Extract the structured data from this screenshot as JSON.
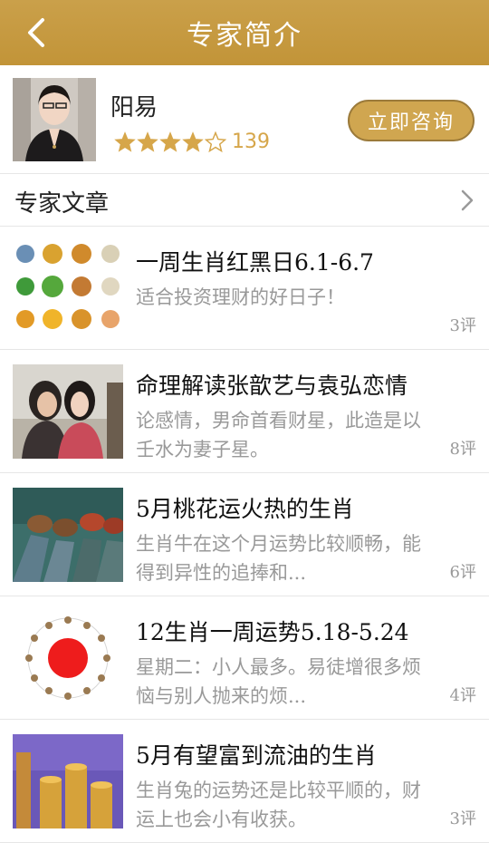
{
  "nav": {
    "title": "专家简介",
    "back_icon": "chevron-left-icon"
  },
  "colors": {
    "nav_bg": "#c29438",
    "accent": "#d0a650",
    "star": "#d6a64a",
    "muted": "#999999"
  },
  "expert": {
    "name": "阳易",
    "rating_stars": 4,
    "rating_max": 5,
    "rating_count": "139",
    "consult_label": "立即咨询"
  },
  "articles_section": {
    "label": "专家文章",
    "more_icon": "chevron-right-icon"
  },
  "articles": [
    {
      "title": "一周生肖红黑日6.1-6.7",
      "desc": "适合投资理财的好日子！",
      "comments": "3评",
      "thumb": "zodiac-grid"
    },
    {
      "title": "命理解读张歆艺与袁弘恋情",
      "desc": "论感情，男命首看财星，此造是以壬水为妻子星。",
      "comments": "8评",
      "thumb": "couple-photo"
    },
    {
      "title": "5月桃花运火热的生肖",
      "desc": "生肖牛在这个月运势比较顺畅，能得到异性的追捧和...",
      "comments": "6评",
      "thumb": "shoes-photo"
    },
    {
      "title": "12生肖一周运势5.18-5.24",
      "desc": "星期二：小人最多。易徒增很多烦恼与别人抛来的烦...",
      "comments": "4评",
      "thumb": "zodiac-wheel"
    },
    {
      "title": "5月有望富到流油的生肖",
      "desc": "生肖兔的运势还是比较平顺的，财运上也会小有收获。",
      "comments": "3评",
      "thumb": "coins-photo"
    }
  ]
}
